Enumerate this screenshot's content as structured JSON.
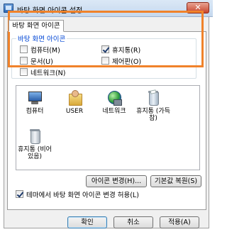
{
  "window": {
    "title": "바탕 화면 아이콘 설정",
    "close_label": "✕"
  },
  "tab": {
    "label": "바탕 화면 아이콘"
  },
  "group": {
    "legend": "바탕 화면 아이콘",
    "checkboxes": [
      {
        "label": "컴퓨터(M)",
        "checked": false
      },
      {
        "label": "휴지통(R)",
        "checked": true
      },
      {
        "label": "문서(U)",
        "checked": false
      },
      {
        "label": "제어판(O)",
        "checked": false
      },
      {
        "label": "네트워크(N)",
        "checked": false
      }
    ]
  },
  "icons": [
    {
      "label": "컴퓨터",
      "icon": "computer-icon"
    },
    {
      "label": "USER",
      "icon": "user-folder-icon"
    },
    {
      "label": "네트워크",
      "icon": "network-icon"
    },
    {
      "label": "휴지통 (가득 참)",
      "icon": "recycle-bin-full-icon"
    },
    {
      "label": "휴지통 (비어 있음)",
      "icon": "recycle-bin-empty-icon"
    }
  ],
  "buttons": {
    "change_icon": "아이콘 변경(H)...",
    "restore_default": "기본값 복원(S)",
    "ok": "확인",
    "cancel": "취소",
    "apply": "적용(A)"
  },
  "theme_option": {
    "label": "테마에서 바탕 화면 아이콘 변경 허용(L)",
    "checked": true
  }
}
